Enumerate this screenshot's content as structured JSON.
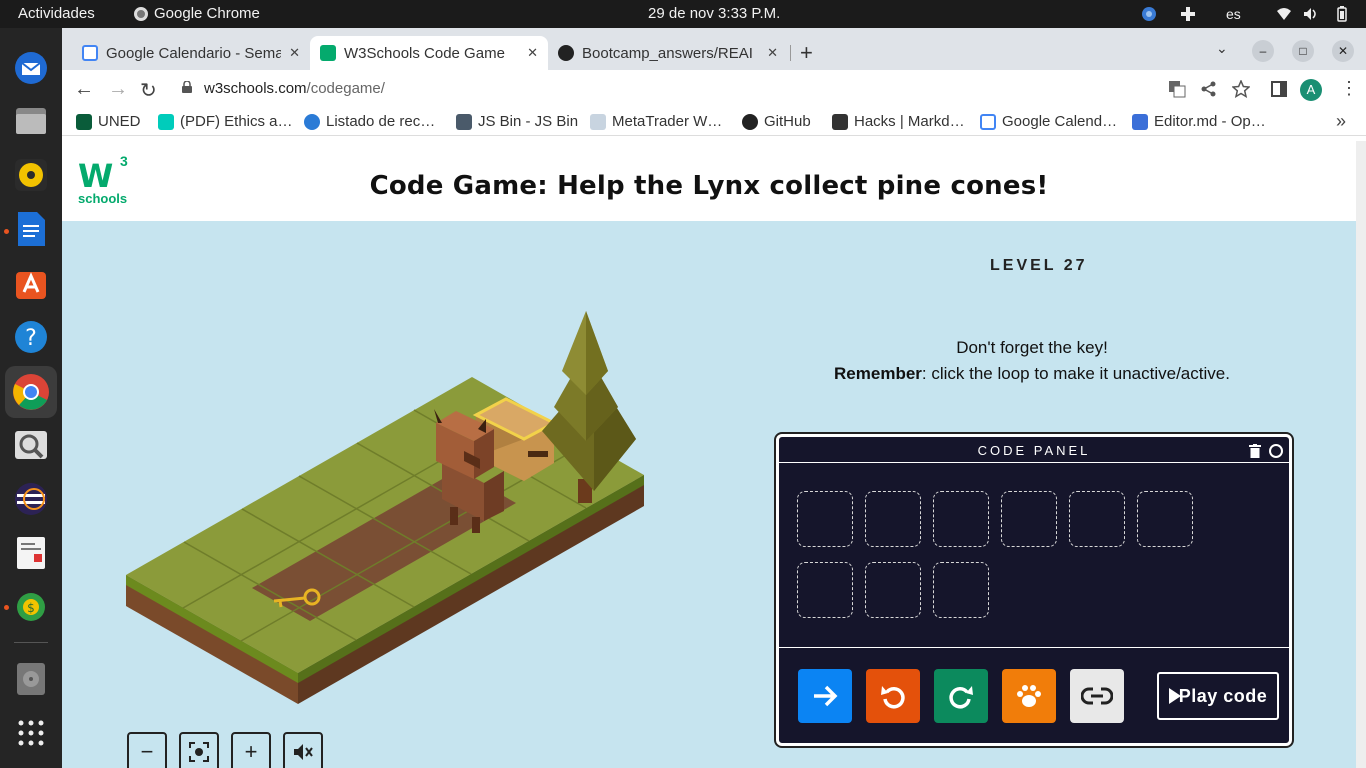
{
  "os": {
    "activities": "Actividades",
    "app_name": "Google Chrome",
    "clock": "29 de nov   3:33 P.M.",
    "language": "es"
  },
  "dock": {
    "items": [
      "thunderbird-icon",
      "files-icon",
      "rhythmbox-icon",
      "libreoffice-writer-icon",
      "software-center-icon",
      "help-icon",
      "chrome-icon",
      "image-viewer-icon",
      "eclipse-icon",
      "document-viewer-icon",
      "metatrader-icon",
      "disk-icon",
      "app-grid-icon"
    ]
  },
  "browser": {
    "tabs": [
      {
        "title": "Google Calendario - Sema",
        "active": false
      },
      {
        "title": "W3Schools Code Game",
        "active": true
      },
      {
        "title": "Bootcamp_answers/REAI",
        "active": false
      }
    ],
    "url_host": "w3schools.com",
    "url_path": "/codegame/",
    "avatar_letter": "A",
    "bookmarks": [
      {
        "label": "UNED"
      },
      {
        "label": "(PDF) Ethics a…"
      },
      {
        "label": "Listado de rec…"
      },
      {
        "label": "JS Bin - JS Bin"
      },
      {
        "label": "MetaTrader W…"
      },
      {
        "label": "GitHub"
      },
      {
        "label": "Hacks | Markd…"
      },
      {
        "label": "Google Calend…"
      },
      {
        "label": "Editor.md - Op…"
      }
    ]
  },
  "page": {
    "logo_text": "schools",
    "logo_sup": "3",
    "title": "Code Game: Help the Lynx collect pine cones!",
    "level": "LEVEL 27",
    "hint_line1": "Don't forget the key!",
    "hint_remember": "Remember",
    "hint_line2_rest": ": click the loop to make it unactive/active."
  },
  "code_panel": {
    "title": "CODE PANEL",
    "slots": 9,
    "commands": [
      {
        "name": "forward",
        "color": "#0b84f3"
      },
      {
        "name": "turn-left",
        "color": "#e4510b"
      },
      {
        "name": "turn-right",
        "color": "#0c8a5d"
      },
      {
        "name": "paw",
        "color": "#f17d0a"
      },
      {
        "name": "loop",
        "color": "#e8e8e8"
      }
    ],
    "play_label": "Play code"
  },
  "colors": {
    "page_bg": "#c6e4ef",
    "panel_bg": "#15152b",
    "brand": "#04aa6d"
  }
}
